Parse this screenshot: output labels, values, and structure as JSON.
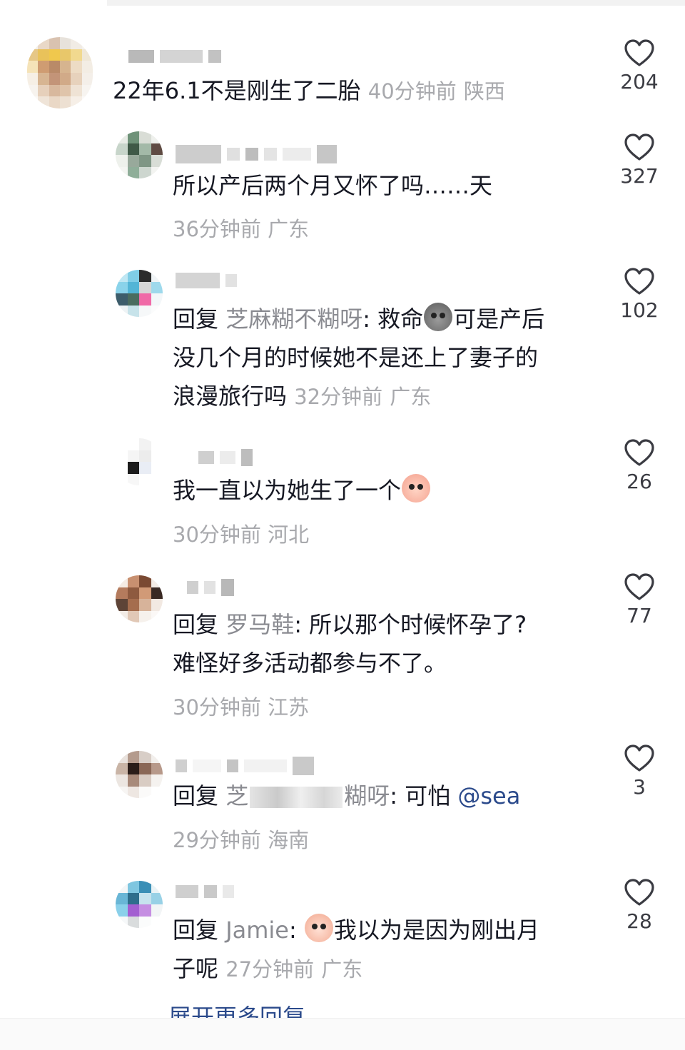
{
  "colors": {
    "text": "#161823",
    "secondary": "#a8a9ad",
    "link": "#2b4a8b",
    "heart": "#3a3b42"
  },
  "comments": [
    {
      "text": "22年6.1不是刚生了二胎",
      "time": "40分钟前",
      "location": "陕西",
      "likes": "204"
    },
    {
      "text": "所以产后两个月又怀了吗……天",
      "time": "36分钟前",
      "location": "广东",
      "likes": "327"
    },
    {
      "reply_prefix": "回复",
      "reply_to": "芝麻糊不糊呀",
      "line1": "救命",
      "line1b": "可是产后",
      "line2": "没几个月的时候她不是还上了妻子的",
      "line3": "浪漫旅行吗",
      "time": "32分钟前",
      "location": "广东",
      "likes": "102",
      "emoji": "sack-emoji"
    },
    {
      "text": "我一直以为她生了一个",
      "time": "30分钟前",
      "location": "河北",
      "likes": "26",
      "emoji": "crying-face-emoji"
    },
    {
      "reply_prefix": "回复",
      "reply_to": "罗马鞋",
      "line1": "所以那个时候怀孕了?",
      "line2": "难怪好多活动都参与不了。",
      "time": "30分钟前",
      "location": "江苏",
      "likes": "77"
    },
    {
      "reply_prefix": "回复",
      "reply_to_start": "芝",
      "reply_to_end": "糊呀",
      "line1": "可怕",
      "mention": "@sea",
      "time": "29分钟前",
      "location": "海南",
      "likes": "3"
    },
    {
      "reply_prefix": "回复",
      "reply_to": "Jamie",
      "line1": "我以为是因为刚出月",
      "line2": "子呢",
      "time": "27分钟前",
      "location": "广东",
      "likes": "28",
      "emoji": "sweating-face-emoji"
    }
  ],
  "expand_label": "展开更多回复",
  "icons": {
    "like": "heart-outline-icon"
  }
}
